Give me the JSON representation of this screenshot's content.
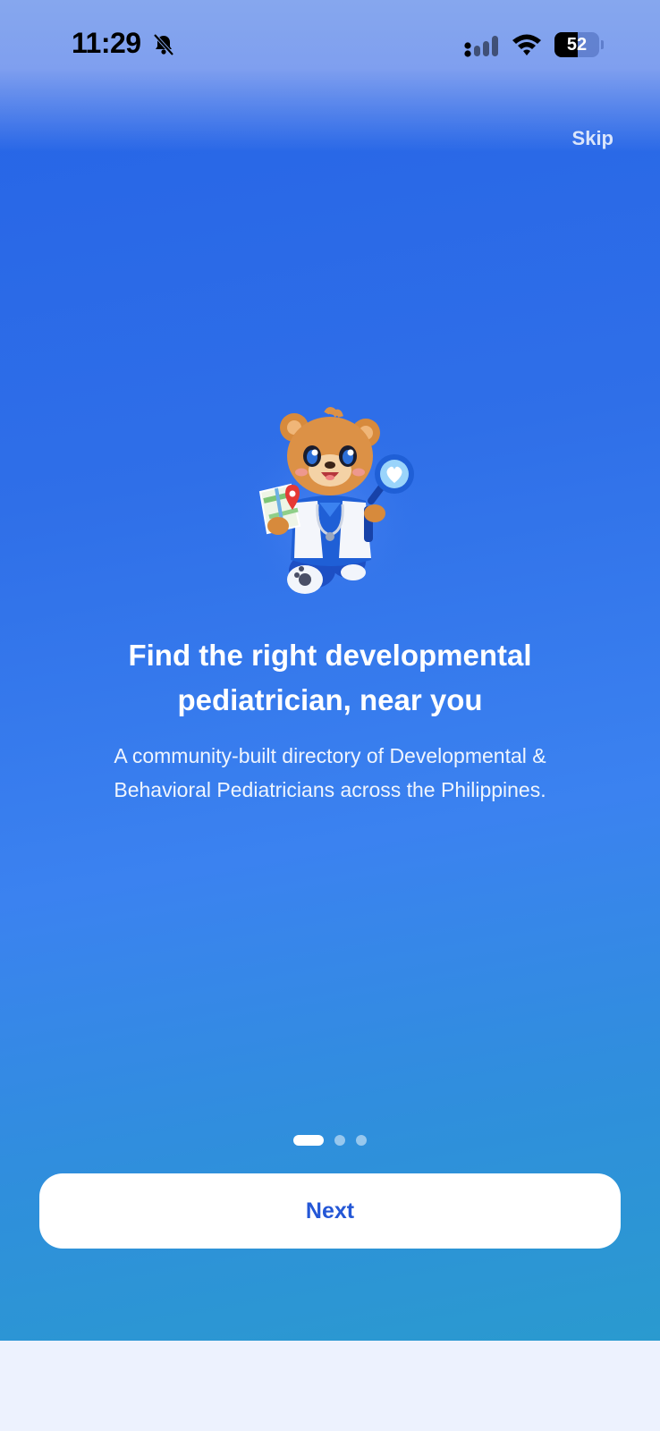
{
  "status_bar": {
    "time": "11:29",
    "battery_level": "52",
    "battery_fraction": 0.52,
    "icons": [
      "bell-slash-icon",
      "cellular-signal-icon",
      "wifi-icon",
      "battery-icon"
    ]
  },
  "onboarding": {
    "skip_label": "Skip",
    "title": "Find the right developmental pediatrician, near you",
    "description": "A community-built directory of Developmental & Behavioral Pediatricians across the Philippines.",
    "illustration": "bear-doctor-mascot",
    "pagination": {
      "current": 1,
      "total": 3
    },
    "next_label": "Next"
  },
  "colors": {
    "background_top": "#2563e6",
    "background_bottom": "#2a9acf",
    "button_text": "#2457d6",
    "button_bg": "#ffffff",
    "page_bottom": "#edf2fe"
  }
}
